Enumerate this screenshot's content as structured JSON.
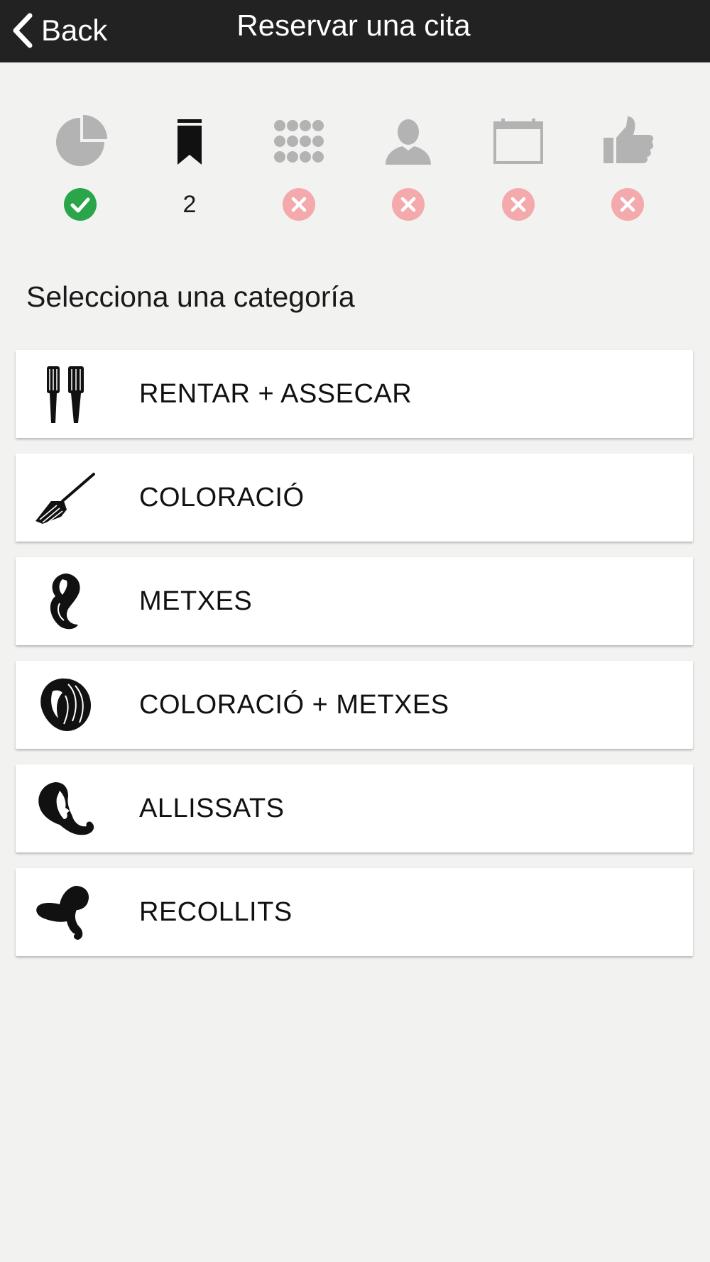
{
  "header": {
    "back_label": "Back",
    "title": "Reservar una cita"
  },
  "steps": [
    {
      "icon": "pie-chart-icon",
      "status": "done"
    },
    {
      "icon": "bookmark-icon",
      "status": "current",
      "number": "2"
    },
    {
      "icon": "grid-dots-icon",
      "status": "pending"
    },
    {
      "icon": "user-icon",
      "status": "pending"
    },
    {
      "icon": "calendar-icon",
      "status": "pending"
    },
    {
      "icon": "thumbs-up-icon",
      "status": "pending"
    }
  ],
  "section_title": "Selecciona una categoría",
  "categories": [
    {
      "label": "RENTAR + ASSECAR",
      "icon": "hair-brushes-icon"
    },
    {
      "label": "COLORACIÓ",
      "icon": "dye-brush-icon"
    },
    {
      "label": "METXES",
      "icon": "hair-highlights-icon"
    },
    {
      "label": "COLORACIÓ + METXES",
      "icon": "hair-color-highlights-icon"
    },
    {
      "label": "ALLISSATS",
      "icon": "woman-hair-profile-icon"
    },
    {
      "label": "RECOLLITS",
      "icon": "updo-hair-icon"
    }
  ],
  "colors": {
    "header_bg": "#222222",
    "page_bg": "#f2f2f1",
    "done_green": "#2aa54a",
    "pending_pink": "#f4a9ad",
    "inactive_gray": "#b3b3b3"
  }
}
